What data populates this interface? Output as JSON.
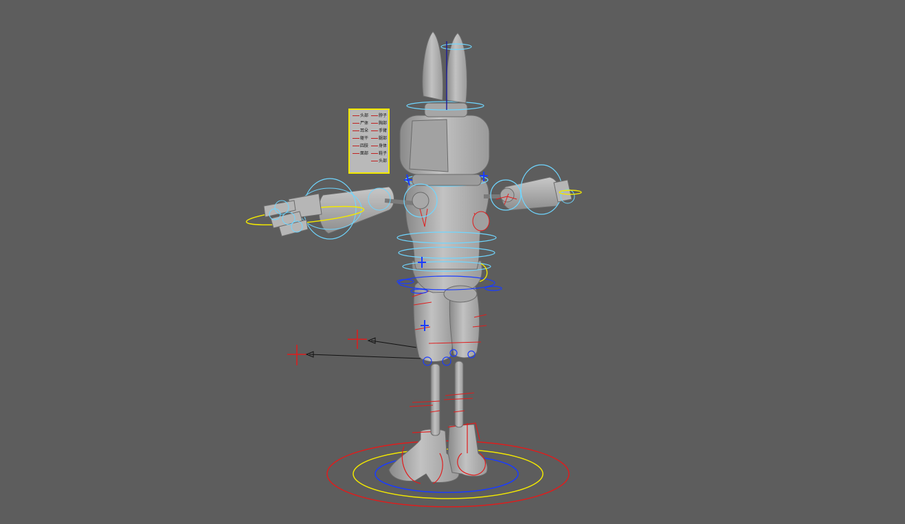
{
  "viewport": {
    "background": "#5d5d5d",
    "model_fill": "#b6b6b6",
    "model_shade": "#8c8c8c",
    "control_colors": {
      "cyan": "#6fd6ff",
      "red": "#e01c1c",
      "yellow": "#f2e800",
      "blue": "#1a3cff",
      "black": "#111111"
    }
  },
  "attribute_card": {
    "left_column": [
      "头部",
      "尸体",
      "耳朵",
      "躯干",
      "四肢",
      "面部"
    ],
    "right_column": [
      "脖子",
      "胸部",
      "手臂",
      "腿部",
      "身体",
      "鞋子",
      "头部"
    ]
  }
}
